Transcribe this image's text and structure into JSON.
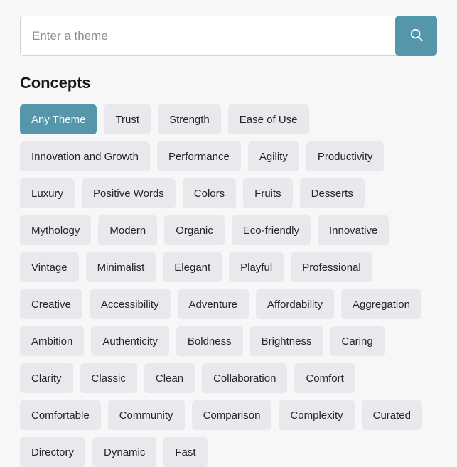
{
  "search": {
    "placeholder": "Enter a theme",
    "value": "",
    "button_icon": "search-icon",
    "button_color": "#5596ab"
  },
  "concepts": {
    "title": "Concepts",
    "active": "Any Theme",
    "chip_color": "#e8e8ed",
    "active_chip_color": "#5596ab",
    "items": [
      "Any Theme",
      "Trust",
      "Strength",
      "Ease of Use",
      "Innovation and Growth",
      "Performance",
      "Agility",
      "Productivity",
      "Luxury",
      "Positive Words",
      "Colors",
      "Fruits",
      "Desserts",
      "Mythology",
      "Modern",
      "Organic",
      "Eco-friendly",
      "Innovative",
      "Vintage",
      "Minimalist",
      "Elegant",
      "Playful",
      "Professional",
      "Creative",
      "Accessibility",
      "Adventure",
      "Affordability",
      "Aggregation",
      "Ambition",
      "Authenticity",
      "Boldness",
      "Brightness",
      "Caring",
      "Clarity",
      "Classic",
      "Clean",
      "Collaboration",
      "Comfort",
      "Comfortable",
      "Community",
      "Comparison",
      "Complexity",
      "Curated",
      "Directory",
      "Dynamic",
      "Fast"
    ]
  },
  "theme": {
    "page_background": "#f7f7f7",
    "accent": "#5596ab"
  }
}
